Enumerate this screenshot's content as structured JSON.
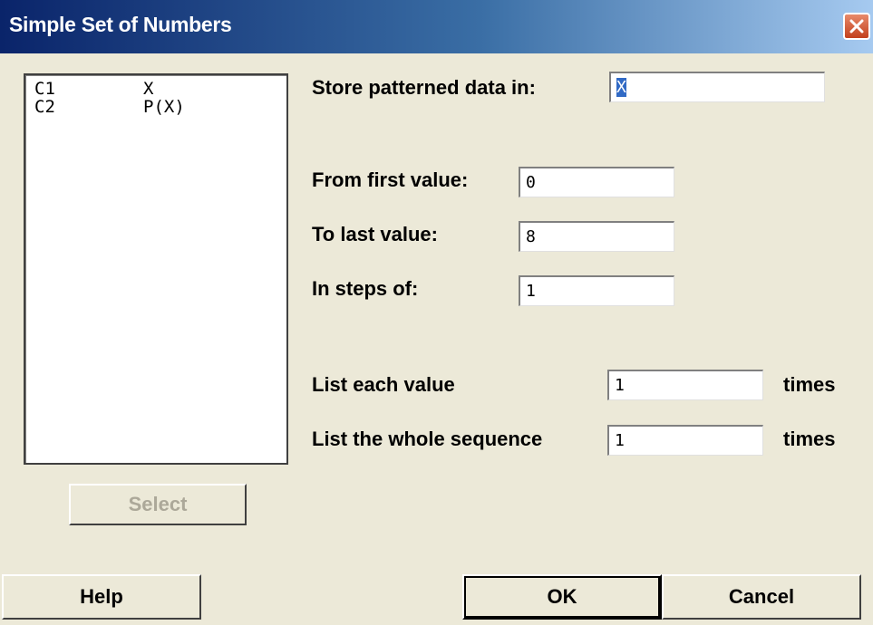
{
  "window": {
    "title": "Simple Set of Numbers"
  },
  "columns": [
    {
      "id": "C1",
      "name": "X"
    },
    {
      "id": "C2",
      "name": "P(X)"
    }
  ],
  "form": {
    "store_label": "Store patterned data in:",
    "store_value": "X",
    "from_label": "From first value:",
    "from_value": "0",
    "to_label": "To last value:",
    "to_value": "8",
    "steps_label": "In steps of:",
    "steps_value": "1",
    "list_each_label": "List each value",
    "list_each_value": "1",
    "list_each_unit": "times",
    "list_seq_label": "List the whole sequence",
    "list_seq_value": "1",
    "list_seq_unit": "times"
  },
  "buttons": {
    "select": "Select",
    "help": "Help",
    "ok": "OK",
    "cancel": "Cancel"
  },
  "icons": {
    "close": "close-icon"
  },
  "colors": {
    "dialog_bg": "#ece9d8",
    "title_bar": "#0a246a",
    "close_button": "#c2401c",
    "selection": "#316ac5"
  }
}
